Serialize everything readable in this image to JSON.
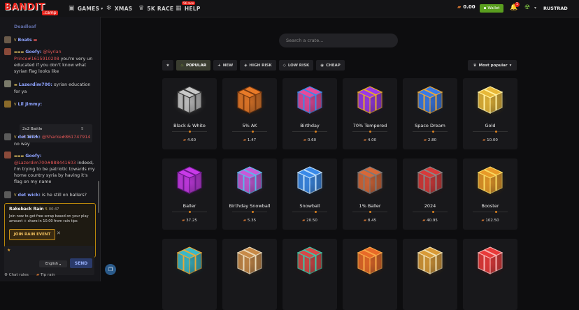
{
  "header": {
    "logo_text": "BANDIT",
    "logo_sub": ".camp",
    "nav": [
      {
        "label": "GAMES",
        "icon": "controller-icon"
      },
      {
        "label": "XMAS",
        "icon": "snowflake-icon"
      },
      {
        "label": "5K RACE",
        "icon": "crown-icon"
      },
      {
        "label": "HELP",
        "icon": "help-icon"
      }
    ],
    "race_badge": "5K race",
    "balance": "0.00",
    "wallet_label": "Wallet",
    "notification_count": "1",
    "username": "RUSTRAD"
  },
  "chat": {
    "messages": [
      {
        "user": "Deadleaf",
        "text": ""
      },
      {
        "user": "Boats",
        "text": ""
      },
      {
        "user": "Goofy:",
        "mention": "@Syrian Prince#1615910208",
        "text": " you're very un educated if you don't know what syrian flag looks like"
      },
      {
        "user": "Lazerdim700:",
        "text": " syrian education for ya"
      },
      {
        "user": "Lil Jimmy:",
        "text": ""
      },
      {
        "user": "det wick:",
        "mention": "@Sharke#861747914",
        "text": " no way"
      },
      {
        "user": "Goofy:",
        "mention": "@Lazerdim700#888441603",
        "text": " indeed, I'm trying to be patriotic towards my home country syria by having it's flag on my name"
      },
      {
        "user": "det wick:",
        "text": " is he still on ballers?"
      }
    ],
    "battle": {
      "title": "2v2 Battle",
      "amount": "32.14",
      "players": "5"
    },
    "rain": {
      "title": "Rakeback Rain",
      "count": "5",
      "timer": "00:47",
      "text": "Join now to get free scrap based on your play amount + share in 10.00 from rain tips",
      "join_label": "JOIN RAIN EVENT"
    },
    "language": "English",
    "send_label": "SEND",
    "rules_label": "Chat rules",
    "tip_rain_label": "Tip rain"
  },
  "main": {
    "search_placeholder": "Search a crate...",
    "filters": [
      {
        "label": "POPULAR",
        "active": true
      },
      {
        "label": "NEW",
        "active": false
      },
      {
        "label": "HIGH RISK",
        "active": false
      },
      {
        "label": "LOW RISK",
        "active": false
      },
      {
        "label": "CHEAP",
        "active": false
      }
    ],
    "sort_label": "Most popular",
    "crates": [
      {
        "name": "Black & White",
        "price": "4.60",
        "color": "#c8c8c8",
        "band": "#3a3a3a"
      },
      {
        "name": "5% AK",
        "price": "1.47",
        "color": "#e87a28",
        "band": "#7a3a10"
      },
      {
        "name": "Birthday",
        "price": "0.60",
        "color": "#e84a9a",
        "band": "#3a8ae8"
      },
      {
        "name": "70% Tempered",
        "price": "4.00",
        "color": "#9a3ae8",
        "band": "#e8a828"
      },
      {
        "name": "Space Dream",
        "price": "2.80",
        "color": "#3a7ae8",
        "band": "#e8a838"
      },
      {
        "name": "Gold",
        "price": "10.00",
        "color": "#e8b838",
        "band": "#fff0a0"
      },
      {
        "name": "Baller",
        "price": "37.25",
        "color": "#c83ae8",
        "band": "#6a1a8a"
      },
      {
        "name": "Birthday Snowball",
        "price": "5.35",
        "color": "#c85ad8",
        "band": "#5ab8e8"
      },
      {
        "name": "Snowball",
        "price": "20.50",
        "color": "#3a8ae8",
        "band": "#bcdcf8"
      },
      {
        "name": "1% Baller",
        "price": "8.45",
        "color": "#d86838",
        "band": "#7a7a7a"
      },
      {
        "name": "2024",
        "price": "40.95",
        "color": "#d83a3a",
        "band": "#888888"
      },
      {
        "name": "Booster",
        "price": "102.50",
        "color": "#e89a28",
        "band": "#f8d860"
      },
      {
        "name": "",
        "price": "",
        "color": "#3ab8c8",
        "band": "#e8a838"
      },
      {
        "name": "",
        "price": "",
        "color": "#c88a48",
        "band": "#e8d8b8"
      },
      {
        "name": "",
        "price": "",
        "color": "#d84848",
        "band": "#3ac8a8"
      },
      {
        "name": "",
        "price": "",
        "color": "#e86a28",
        "band": "#f8a848"
      },
      {
        "name": "",
        "price": "",
        "color": "#d89a38",
        "band": "#f0e0b0"
      },
      {
        "name": "",
        "price": "",
        "color": "#e83a3a",
        "band": "#f8b0b0"
      }
    ]
  }
}
